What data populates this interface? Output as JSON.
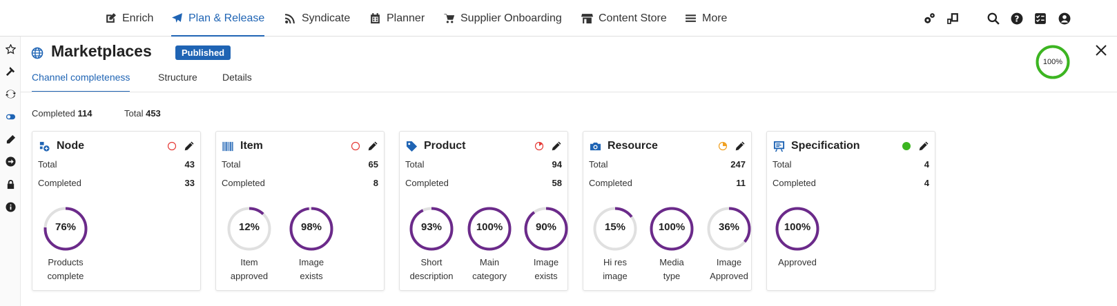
{
  "nav": {
    "items": [
      {
        "label": "Enrich",
        "icon": "edit-square-icon"
      },
      {
        "label": "Plan & Release",
        "icon": "paper-plane-icon"
      },
      {
        "label": "Syndicate",
        "icon": "rss-icon"
      },
      {
        "label": "Planner",
        "icon": "calendar-icon"
      },
      {
        "label": "Supplier Onboarding",
        "icon": "cart-icon"
      },
      {
        "label": "Content Store",
        "icon": "store-icon"
      },
      {
        "label": "More",
        "icon": "hamburger-icon"
      }
    ],
    "active_index": 1,
    "right_icons": [
      "gears-icon",
      "device-icon",
      "search-icon",
      "help-icon",
      "checklist-icon",
      "user-icon"
    ]
  },
  "sidebar": {
    "icons": [
      "star-icon",
      "hammer-icon",
      "sync-icon",
      "toggle-icon",
      "pencil-icon",
      "arrow-circle-icon",
      "lock-icon",
      "info-icon"
    ]
  },
  "header": {
    "title": "Marketplaces",
    "badge": "Published",
    "tabs": [
      "Channel completeness",
      "Structure",
      "Details"
    ],
    "active_tab": 0,
    "overall_completion": {
      "value": 100,
      "label": "100%"
    }
  },
  "summary": {
    "completed_label": "Completed",
    "completed_value": "114",
    "total_label": "Total",
    "total_value": "453"
  },
  "colors": {
    "accent": "#1f64b4",
    "gauge": "#6b2a8a",
    "gauge_track": "#e0e0e0",
    "overall_ring": "#3cb521",
    "status_empty": "#e53935",
    "status_partial_low": "#e53935",
    "status_partial_mid": "#f0a020",
    "status_full": "#3cb521"
  },
  "cards": [
    {
      "title": "Node",
      "icon": "node-icon",
      "status": "empty",
      "total_label": "Total",
      "total": "43",
      "completed_label": "Completed",
      "completed": "33",
      "gauges": [
        {
          "pct": 76,
          "pct_label": "76%",
          "line1": "Products",
          "line2": "complete"
        }
      ]
    },
    {
      "title": "Item",
      "icon": "barcode-icon",
      "status": "empty",
      "total_label": "Total",
      "total": "65",
      "completed_label": "Completed",
      "completed": "8",
      "gauges": [
        {
          "pct": 12,
          "pct_label": "12%",
          "line1": "Item",
          "line2": "approved"
        },
        {
          "pct": 98,
          "pct_label": "98%",
          "line1": "Image",
          "line2": "exists"
        }
      ]
    },
    {
      "title": "Product",
      "icon": "tag-icon",
      "status": "partial-low",
      "total_label": "Total",
      "total": "94",
      "completed_label": "Completed",
      "completed": "58",
      "gauges": [
        {
          "pct": 93,
          "pct_label": "93%",
          "line1": "Short",
          "line2": "description"
        },
        {
          "pct": 100,
          "pct_label": "100%",
          "line1": "Main",
          "line2": "category"
        },
        {
          "pct": 90,
          "pct_label": "90%",
          "line1": "Image",
          "line2": "exists"
        }
      ]
    },
    {
      "title": "Resource",
      "icon": "camera-icon",
      "status": "partial-mid",
      "total_label": "Total",
      "total": "247",
      "completed_label": "Completed",
      "completed": "11",
      "gauges": [
        {
          "pct": 15,
          "pct_label": "15%",
          "line1": "Hi res",
          "line2": "image"
        },
        {
          "pct": 100,
          "pct_label": "100%",
          "line1": "Media",
          "line2": "type"
        },
        {
          "pct": 36,
          "pct_label": "36%",
          "line1": "Image",
          "line2": "Approved"
        }
      ]
    },
    {
      "title": "Specification",
      "icon": "spec-board-icon",
      "status": "full",
      "total_label": "Total",
      "total": "4",
      "completed_label": "Completed",
      "completed": "4",
      "gauges": [
        {
          "pct": 100,
          "pct_label": "100%",
          "line1": "Approved",
          "line2": ""
        }
      ]
    }
  ]
}
